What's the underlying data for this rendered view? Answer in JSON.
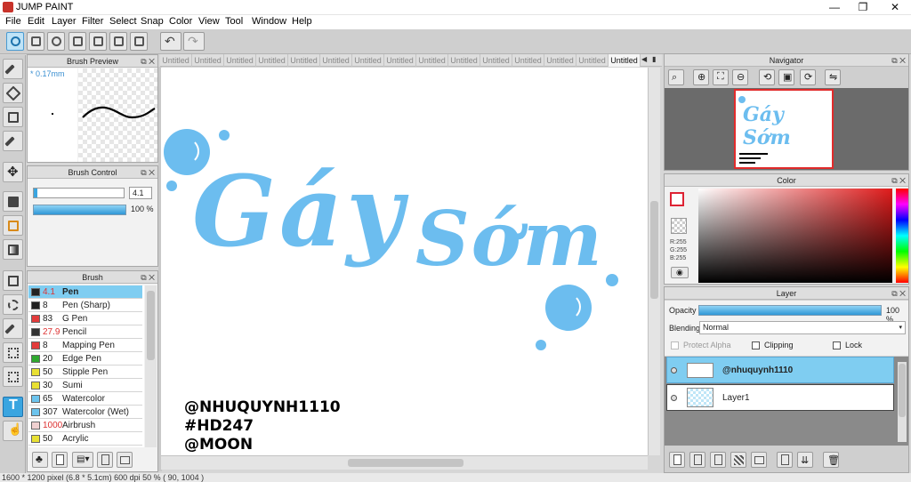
{
  "app": {
    "title": "JUMP PAINT"
  },
  "window_controls": {
    "minimize": "—",
    "maximize": "❐",
    "close": "✕"
  },
  "menu": [
    "File",
    "Edit",
    "Layer",
    "Filter",
    "Select",
    "Snap",
    "Color",
    "View",
    "Tool",
    "Window",
    "Help"
  ],
  "tabs": [
    "Untitled",
    "Untitled",
    "Untitled",
    "Untitled",
    "Untitled",
    "Untitled",
    "Untitled",
    "Untitled",
    "Untitled",
    "Untitled",
    "Untitled",
    "Untitled",
    "Untitled",
    "Untitled",
    "Untitled"
  ],
  "brush_preview": {
    "title": "Brush Preview",
    "size_label": "* 0.17mm"
  },
  "brush_control": {
    "title": "Brush Control",
    "size_value": "4.1",
    "opacity_value": "100 %"
  },
  "brush_panel": {
    "title": "Brush",
    "items": [
      {
        "size": "4.1",
        "name": "Pen",
        "color": "#222222",
        "size_color": "#d33",
        "selected": true
      },
      {
        "size": "8",
        "name": "Pen (Sharp)",
        "color": "#222222",
        "size_color": "#222"
      },
      {
        "size": "83",
        "name": "G Pen",
        "color": "#e23b3b",
        "size_color": "#222"
      },
      {
        "size": "27.9",
        "name": "Pencil",
        "color": "#333333",
        "size_color": "#d33"
      },
      {
        "size": "8",
        "name": "Mapping Pen",
        "color": "#e23b3b",
        "size_color": "#222"
      },
      {
        "size": "20",
        "name": "Edge Pen",
        "color": "#2ea82e",
        "size_color": "#222"
      },
      {
        "size": "50",
        "name": "Stipple Pen",
        "color": "#e8e033",
        "size_color": "#222"
      },
      {
        "size": "30",
        "name": "Sumi",
        "color": "#e8e033",
        "size_color": "#222"
      },
      {
        "size": "65",
        "name": "Watercolor",
        "color": "#6cc4ee",
        "size_color": "#222"
      },
      {
        "size": "307",
        "name": "Watercolor (Wet)",
        "color": "#6cc4ee",
        "size_color": "#222"
      },
      {
        "size": "1000",
        "name": "Airbrush",
        "color": "#f0d0d0",
        "size_color": "#d33"
      },
      {
        "size": "50",
        "name": "Acrylic",
        "color": "#e8e033",
        "size_color": "#222"
      }
    ]
  },
  "canvas": {
    "text_line1": "Gáy",
    "text_line2": "Sớm",
    "credit_1": "@NHUQUYNH1110",
    "credit_2": "#HD247",
    "credit_3": "@MOON",
    "ink_color": "#6cbdef"
  },
  "navigator": {
    "title": "Navigator",
    "thumb_text": "Gáy Sớm"
  },
  "color_panel": {
    "title": "Color",
    "r": "R:255",
    "g": "G:255",
    "b": "B:255"
  },
  "layer_panel": {
    "title": "Layer",
    "opacity_label": "Opacity",
    "opacity_value": "100 %",
    "blending_label": "Blending",
    "blending_value": "Normal",
    "protect_alpha": "Protect Alpha",
    "clipping": "Clipping",
    "lock": "Lock",
    "layers": [
      {
        "name": "@nhuquynh1110",
        "selected": true
      },
      {
        "name": "Layer1",
        "selected": false
      }
    ]
  },
  "status": {
    "text": "1600 * 1200 pixel   (6.8 * 5.1cm)   600 dpi   50 %   ( 90, 1004 )"
  },
  "accent": "#3aa5e0"
}
